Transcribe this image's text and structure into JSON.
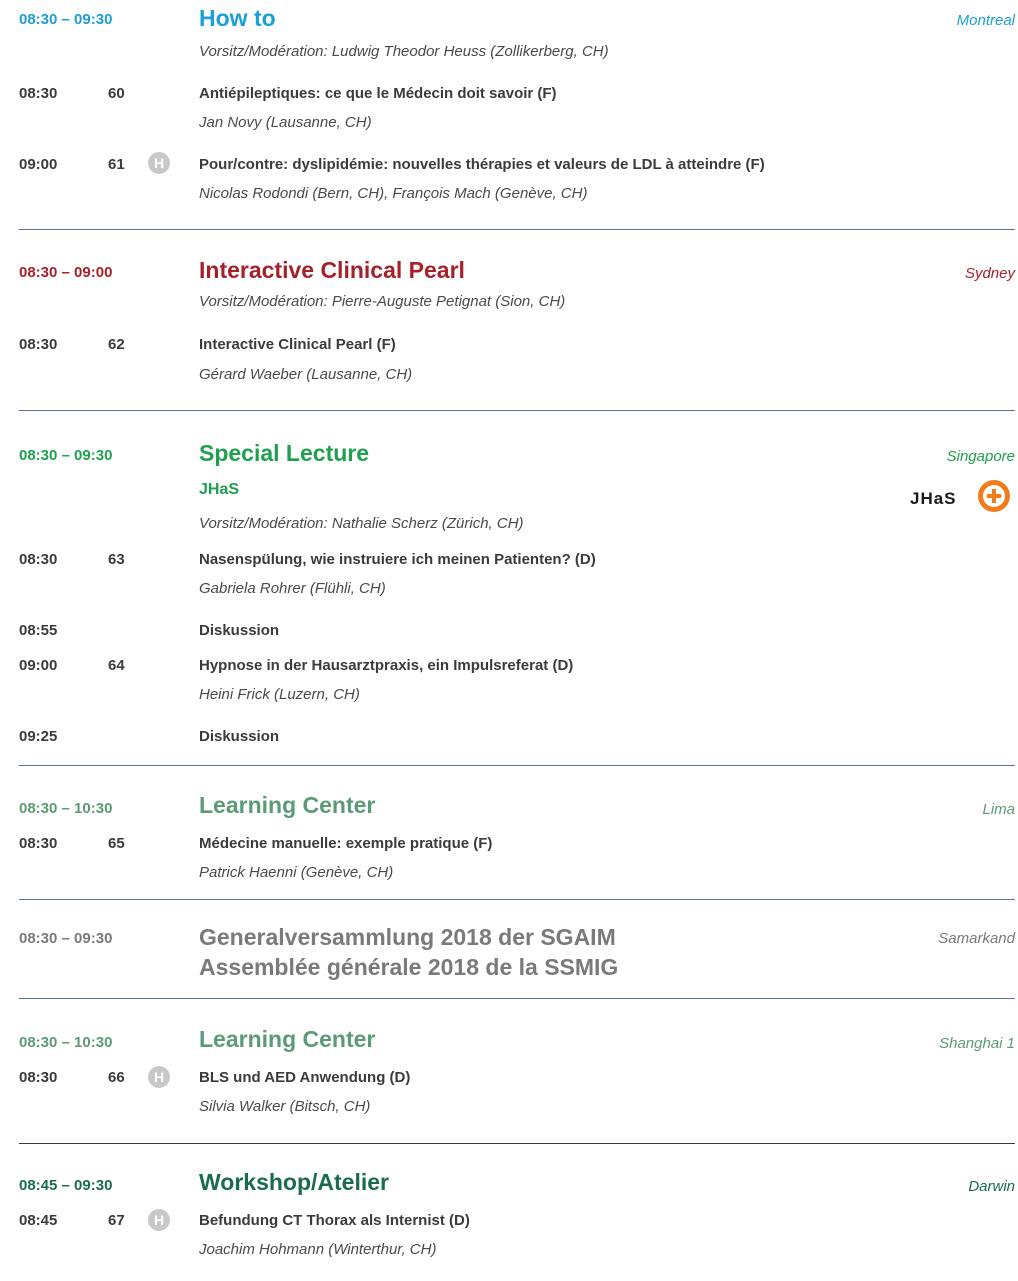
{
  "sessions": [
    {
      "time": "08:30 – 09:30",
      "title": "How to",
      "room": "Montreal",
      "color": "#1a9fd6",
      "chair": "Vorsitz/Modération: Ludwig Theodor Heuss (Zollikerberg, CH)",
      "items": [
        {
          "time": "08:30",
          "num": "60",
          "badge": "",
          "title": "Antiépileptiques: ce que le Médecin doit savoir (F)",
          "speaker": "Jan Novy (Lausanne, CH)"
        },
        {
          "time": "09:00",
          "num": "61",
          "badge": "H",
          "title": "Pour/contre: dyslipidémie: nouvelles thérapies et valeurs de LDL à atteindre (F)",
          "speaker": "Nicolas Rodondi (Bern, CH), François Mach (Genève, CH)"
        }
      ]
    },
    {
      "time": "08:30 – 09:00",
      "title": "Interactive Clinical Pearl",
      "room": "Sydney",
      "color": "#a5222a",
      "chair": "Vorsitz/Modération: Pierre-Auguste Petignat (Sion, CH)",
      "items": [
        {
          "time": "08:30",
          "num": "62",
          "badge": "",
          "title": "Interactive Clinical Pearl (F)",
          "speaker": "Gérard Waeber (Lausanne, CH)"
        }
      ]
    },
    {
      "time": "08:30 – 09:30",
      "title": "Special Lecture",
      "subtitle": "JHaS",
      "room": "Singapore",
      "color": "#1ea04f",
      "chair": "Vorsitz/Modération: Nathalie Scherz (Zürich, CH)",
      "logo_text": "JHaS",
      "items": [
        {
          "time": "08:30",
          "num": "63",
          "badge": "",
          "title": "Nasenspülung, wie instruiere ich meinen Patienten? (D)",
          "speaker": "Gabriela Rohrer (Flühli, CH)"
        },
        {
          "time": "08:55",
          "num": "",
          "badge": "",
          "title": "Diskussion",
          "speaker": ""
        },
        {
          "time": "09:00",
          "num": "64",
          "badge": "",
          "title": "Hypnose in der Hausarztpraxis, ein Impulsreferat (D)",
          "speaker": "Heini Frick (Luzern, CH)"
        },
        {
          "time": "09:25",
          "num": "",
          "badge": "",
          "title": "Diskussion",
          "speaker": ""
        }
      ]
    },
    {
      "time": "08:30 – 10:30",
      "title": "Learning Center",
      "room": "Lima",
      "color": "#5c9a78",
      "items": [
        {
          "time": "08:30",
          "num": "65",
          "badge": "",
          "title": "Médecine manuelle: exemple pratique (F)",
          "speaker": "Patrick Haenni (Genève, CH)"
        }
      ]
    },
    {
      "time": "08:30 – 09:30",
      "title_line1": "Generalversammlung 2018 der SGAIM",
      "title_line2": "Assemblée générale 2018 de la SSMIG",
      "room": "Samarkand",
      "color": "#7a7a7a"
    },
    {
      "time": "08:30 – 10:30",
      "title": "Learning Center",
      "room": "Shanghai 1",
      "color": "#5c9a78",
      "items": [
        {
          "time": "08:30",
          "num": "66",
          "badge": "H",
          "title": "BLS und AED Anwendung (D)",
          "speaker": "Silvia Walker (Bitsch, CH)"
        }
      ]
    },
    {
      "time": "08:45 – 09:30",
      "title": "Workshop/Atelier",
      "room": "Darwin",
      "color": "#1a6b52",
      "items": [
        {
          "time": "08:45",
          "num": "67",
          "badge": "H",
          "title": "Befundung CT Thorax als Internist (D)",
          "speaker": "Joachim Hohmann (Winterthur, CH)"
        }
      ]
    }
  ]
}
